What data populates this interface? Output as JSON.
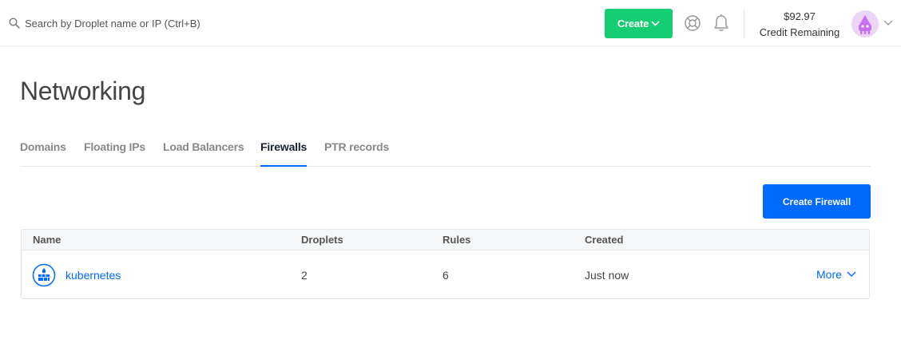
{
  "header": {
    "search_placeholder": "Search by Droplet name or IP (Ctrl+B)",
    "create_label": "Create",
    "credit_amount": "$92.97",
    "credit_label": "Credit Remaining"
  },
  "page": {
    "title": "Networking"
  },
  "tabs": [
    {
      "label": "Domains",
      "active": false
    },
    {
      "label": "Floating IPs",
      "active": false
    },
    {
      "label": "Load Balancers",
      "active": false
    },
    {
      "label": "Firewalls",
      "active": true
    },
    {
      "label": "PTR records",
      "active": false
    }
  ],
  "actions": {
    "create_firewall_label": "Create Firewall"
  },
  "table": {
    "columns": [
      "Name",
      "Droplets",
      "Rules",
      "Created"
    ],
    "rows": [
      {
        "name": "kubernetes",
        "droplets": "2",
        "rules": "6",
        "created": "Just now",
        "action": "More"
      }
    ]
  },
  "colors": {
    "create_green": "#15cd72",
    "primary_blue": "#0069ff",
    "avatar_purple": "#c86ef0"
  },
  "icons": {
    "search": "search-icon",
    "help": "lifebuoy-icon",
    "notifications": "bell-icon",
    "avatar": "sammy-avatar",
    "firewall": "firewall-icon",
    "caret": "chevron-down-icon"
  }
}
